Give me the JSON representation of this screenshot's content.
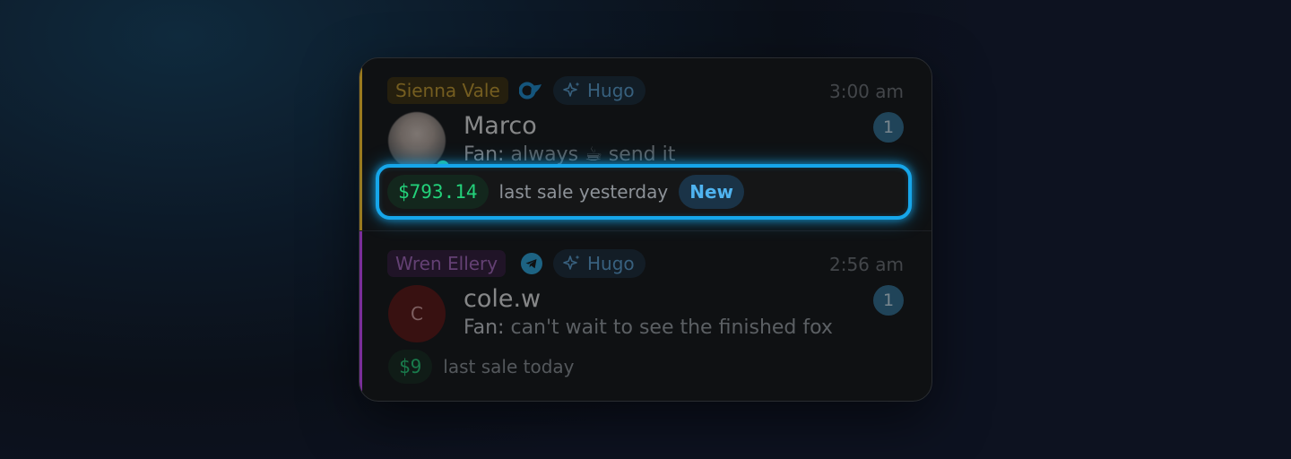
{
  "conversations": [
    {
      "creator": "Sienna Vale",
      "platform_icon": "onlyfans-icon",
      "assistant": "Hugo",
      "time": "3:00 am",
      "fan_name": "Marco",
      "preview_prefix": "Fan:",
      "preview_text": "always ☕ send it",
      "unread": "1",
      "online": true,
      "sale_amount": "$793.14",
      "sale_text": "last sale yesterday",
      "tag": "New",
      "accent_color": "#9a7a1e"
    },
    {
      "creator": "Wren Ellery",
      "platform_icon": "telegram-icon",
      "assistant": "Hugo",
      "time": "2:56 am",
      "fan_name": "cole.w",
      "avatar_initial": "C",
      "preview_prefix": "Fan:",
      "preview_text": "can't wait to see the finished fox",
      "unread": "1",
      "sale_amount": "$9",
      "sale_text": "last sale today",
      "accent_color": "#7a2e9a"
    }
  ],
  "colors": {
    "highlight": "#16a6ea",
    "sale_green": "#23d17a",
    "assistant_blue": "#5aa2d6"
  }
}
